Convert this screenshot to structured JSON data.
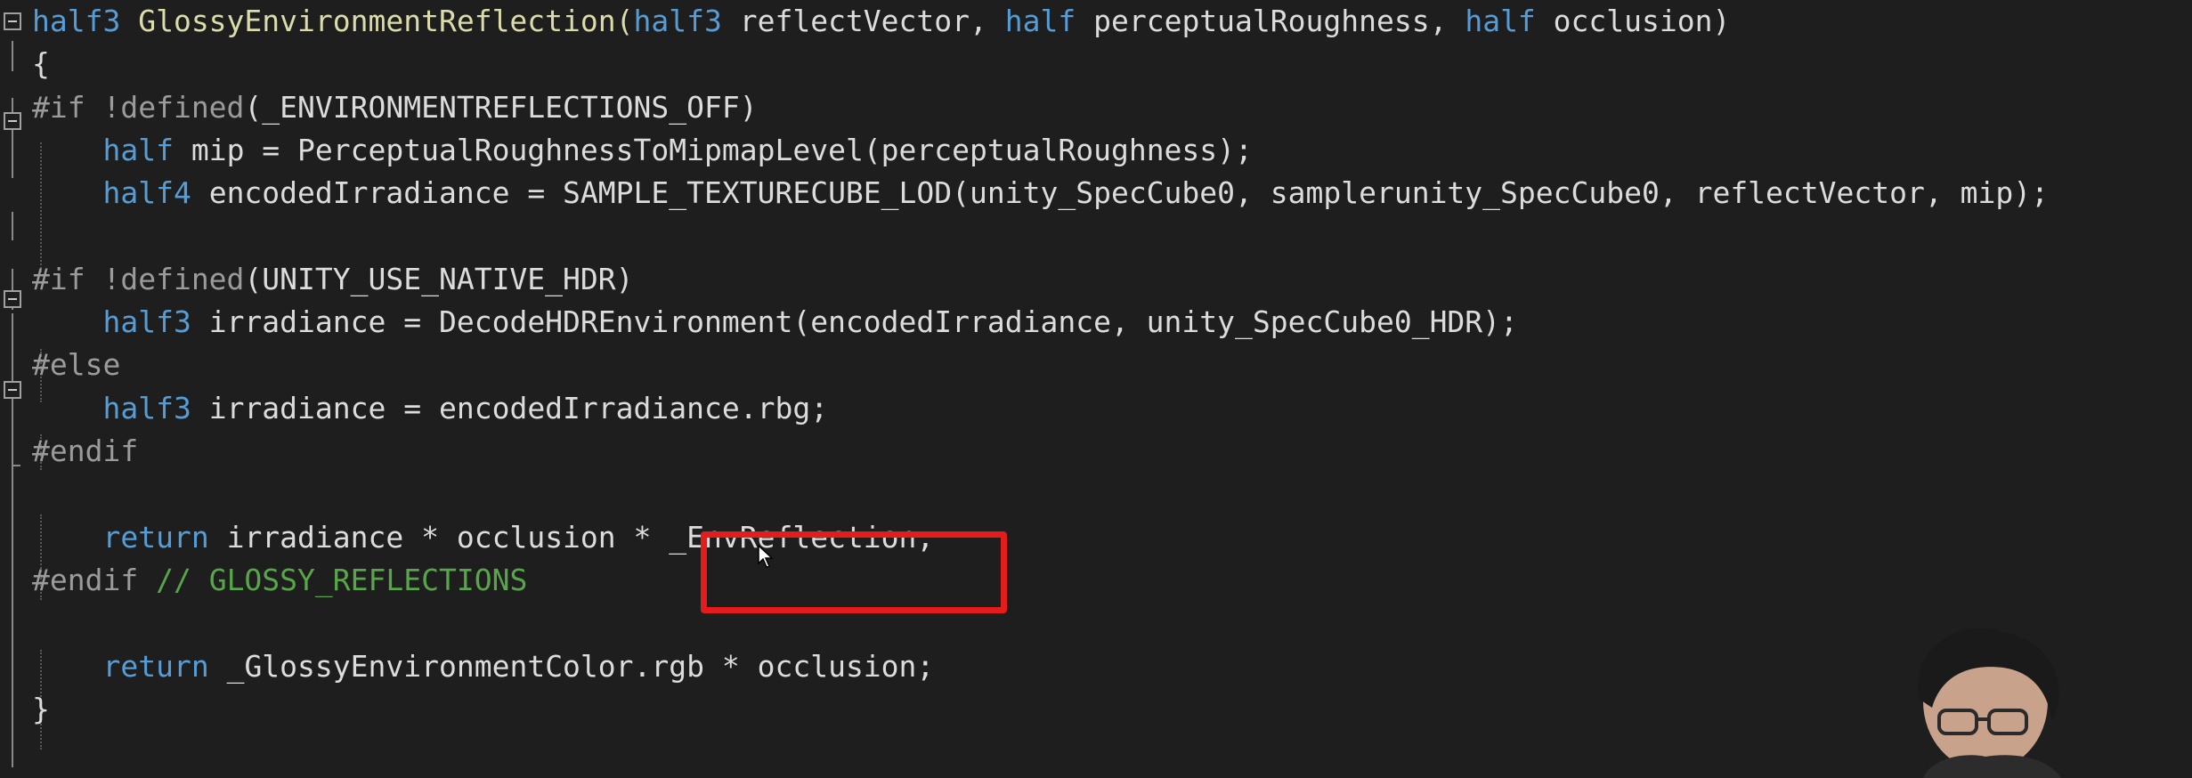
{
  "editor": {
    "lines": [
      {
        "segments": [
          {
            "t": "half3",
            "c": "kw"
          },
          {
            "t": " GlossyEnvironmentReflection(",
            "c": "fn"
          },
          {
            "t": "half3",
            "c": "kw"
          },
          {
            "t": " reflectVector, ",
            "c": ""
          },
          {
            "t": "half",
            "c": "kw"
          },
          {
            "t": " perceptualRoughness, ",
            "c": ""
          },
          {
            "t": "half",
            "c": "kw"
          },
          {
            "t": " occlusion)",
            "c": ""
          }
        ]
      },
      {
        "segments": [
          {
            "t": "{",
            "c": ""
          }
        ]
      },
      {
        "segments": [
          {
            "t": "#if",
            "c": "pp"
          },
          {
            "t": " !defined",
            "c": "pp"
          },
          {
            "t": "(_ENVIRONMENTREFLECTIONS_OFF)",
            "c": ""
          }
        ]
      },
      {
        "segments": [
          {
            "t": "    ",
            "c": ""
          },
          {
            "t": "half",
            "c": "kw"
          },
          {
            "t": " mip = PerceptualRoughnessToMipmapLevel(perceptualRoughness);",
            "c": ""
          }
        ]
      },
      {
        "segments": [
          {
            "t": "    ",
            "c": ""
          },
          {
            "t": "half4",
            "c": "kw"
          },
          {
            "t": " encodedIrradiance = SAMPLE_TEXTURECUBE_LOD(unity_SpecCube0, samplerunity_SpecCube0, reflectVector, mip);",
            "c": ""
          }
        ]
      },
      {
        "segments": []
      },
      {
        "segments": [
          {
            "t": "#if",
            "c": "pp"
          },
          {
            "t": " !defined",
            "c": "pp"
          },
          {
            "t": "(UNITY_USE_NATIVE_HDR)",
            "c": ""
          }
        ]
      },
      {
        "segments": [
          {
            "t": "    ",
            "c": ""
          },
          {
            "t": "half3",
            "c": "kw"
          },
          {
            "t": " irradiance = DecodeHDREnvironment(encodedIrradiance, unity_SpecCube0_HDR);",
            "c": ""
          }
        ]
      },
      {
        "segments": [
          {
            "t": "#else",
            "c": "pp"
          }
        ]
      },
      {
        "segments": [
          {
            "t": "    ",
            "c": ""
          },
          {
            "t": "half3",
            "c": "kw"
          },
          {
            "t": " irradiance = encodedIrradiance.rbg;",
            "c": ""
          }
        ]
      },
      {
        "segments": [
          {
            "t": "#endif",
            "c": "pp"
          }
        ]
      },
      {
        "segments": []
      },
      {
        "segments": [
          {
            "t": "    ",
            "c": ""
          },
          {
            "t": "return",
            "c": "kw"
          },
          {
            "t": " irradiance * occlusion * _EnvReflection;",
            "c": ""
          }
        ]
      },
      {
        "segments": [
          {
            "t": "#endif",
            "c": "pp"
          },
          {
            "t": " ",
            "c": ""
          },
          {
            "t": "// GLOSSY_REFLECTIONS",
            "c": "cm"
          }
        ]
      },
      {
        "segments": []
      },
      {
        "segments": [
          {
            "t": "    ",
            "c": ""
          },
          {
            "t": "return",
            "c": "kw"
          },
          {
            "t": " _GlossyEnvironmentColor.rgb * occlusion;",
            "c": ""
          }
        ]
      },
      {
        "segments": [
          {
            "t": "}",
            "c": ""
          }
        ]
      }
    ]
  },
  "colors": {
    "background": "#1e1e1e",
    "keyword": "#569cd6",
    "preprocessor": "#9b9b9b",
    "comment": "#57a64a",
    "highlight": "#e51c1c"
  }
}
